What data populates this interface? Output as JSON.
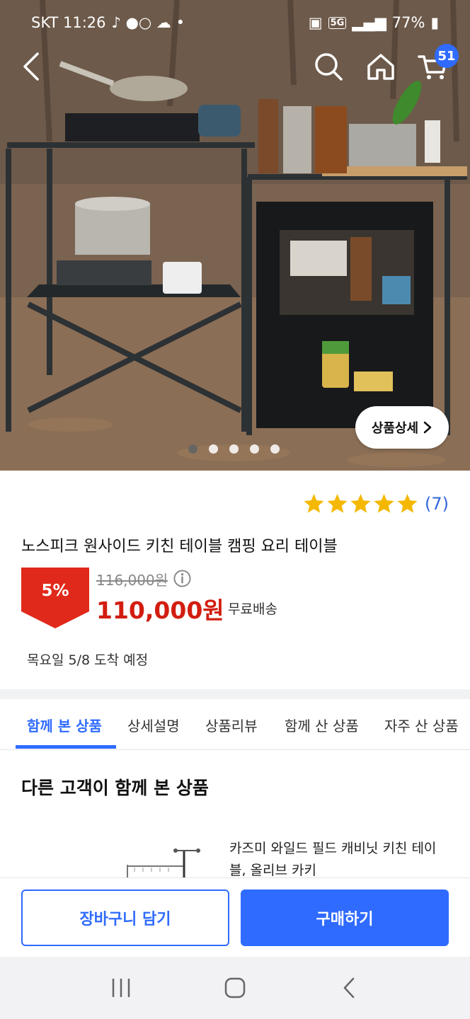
{
  "status_bar": {
    "carrier_time": "SKT 11:26",
    "network": "5G",
    "battery": "77%"
  },
  "header": {
    "cart_count": "51"
  },
  "hero": {
    "detail_button_label": "상품상세",
    "slide_count": 5,
    "active_slide": 1
  },
  "product": {
    "rating_stars": 5,
    "review_count": "(7)",
    "title": "노스피크 원사이드 키친 테이블 캠핑 요리 테이블",
    "discount": "5%",
    "original_price": "116,000원",
    "sale_price": "110,000원",
    "shipping": "무료배송",
    "arrival": "목요일 5/8 도착 예정"
  },
  "tabs": [
    {
      "label": "함께 본 상품",
      "active": true
    },
    {
      "label": "상세설명",
      "active": false
    },
    {
      "label": "상품리뷰",
      "active": false
    },
    {
      "label": "함께 산 상품",
      "active": false
    },
    {
      "label": "자주 산 상품",
      "active": false
    }
  ],
  "section": {
    "title": "다른 고객이 함께 본 상품"
  },
  "recommendation": {
    "name": "카즈미 와일드 필드 캐비닛 키친 테이블, 올리브 카키"
  },
  "actions": {
    "add_to_cart": "장바구니 담기",
    "buy": "구매하기"
  },
  "colors": {
    "accent": "#2f6bff",
    "sale": "#d21d10",
    "star": "#f5b800"
  }
}
